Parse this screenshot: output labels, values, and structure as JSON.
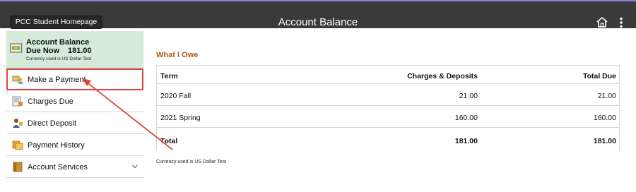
{
  "header": {
    "home_button_label": "PCC Student Homepage",
    "title": "Account Balance",
    "icons": [
      "home-icon",
      "more-options-icon"
    ]
  },
  "sidebar": {
    "summary": {
      "title": "Account Balance",
      "due_label": "Due Now",
      "due_amount": "181.00",
      "currency_note": "Currency used is US Dollar Test",
      "icon": "money-icon"
    },
    "items": [
      {
        "label": "Make a Payment",
        "icon": "payment-icon",
        "highlighted": true
      },
      {
        "label": "Charges Due",
        "icon": "invoice-icon"
      },
      {
        "label": "Direct Deposit",
        "icon": "deposit-icon"
      },
      {
        "label": "Payment History",
        "icon": "history-icon"
      },
      {
        "label": "Account Services",
        "icon": "services-icon",
        "has_dropdown": true
      }
    ]
  },
  "main": {
    "heading": "What I Owe",
    "table": {
      "columns": [
        "Term",
        "Charges & Deposits",
        "Total Due"
      ],
      "rows": [
        [
          "2020 Fall",
          "21.00",
          "21.00"
        ],
        [
          "2021 Spring",
          "160.00",
          "160.00"
        ]
      ],
      "total_row": [
        "Total",
        "181.00",
        "181.00"
      ]
    },
    "currency_note": "Currency used is US Dollar Test"
  },
  "colors": {
    "topbar": "#3a3a3a",
    "summary_bg": "#d5ead8",
    "heading": "#b25b12",
    "annotation": "#e0463f"
  }
}
